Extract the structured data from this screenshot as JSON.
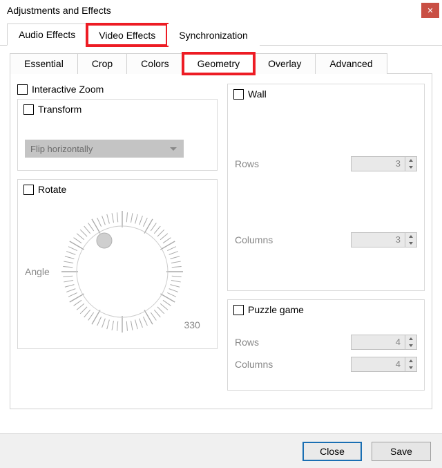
{
  "window": {
    "title": "Adjustments and Effects"
  },
  "highlight_color": "#ed1c24",
  "main_tabs": {
    "audio": "Audio Effects",
    "video": "Video Effects",
    "sync": "Synchronization",
    "highlighted": "video"
  },
  "sub_tabs": {
    "essential": "Essential",
    "crop": "Crop",
    "colors": "Colors",
    "geometry": "Geometry",
    "overlay": "Overlay",
    "advanced": "Advanced",
    "active": "geometry",
    "highlighted": "geometry"
  },
  "geometry": {
    "interactive_zoom": {
      "label": "Interactive Zoom",
      "checked": false
    },
    "transform": {
      "label": "Transform",
      "checked": false,
      "mode": "Flip horizontally"
    },
    "rotate": {
      "label": "Rotate",
      "checked": false,
      "angle_label": "Angle",
      "angle_value": 330,
      "angle_text": "330"
    },
    "wall": {
      "label": "Wall",
      "checked": false,
      "rows_label": "Rows",
      "rows_value": 3,
      "cols_label": "Columns",
      "cols_value": 3
    },
    "puzzle": {
      "label": "Puzzle game",
      "checked": false,
      "rows_label": "Rows",
      "rows_value": 4,
      "cols_label": "Columns",
      "cols_value": 4
    }
  },
  "footer": {
    "close": "Close",
    "save": "Save"
  }
}
